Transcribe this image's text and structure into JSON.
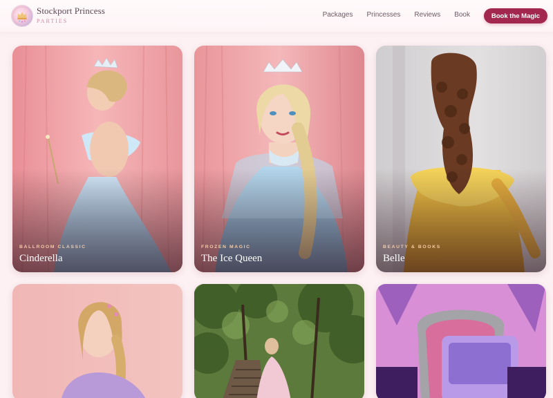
{
  "brand": {
    "name": "Stockport Princess",
    "sub": "PARTIES"
  },
  "nav": {
    "items": [
      "Packages",
      "Princesses",
      "Reviews",
      "Book"
    ],
    "cta": "Book the Magic"
  },
  "colors": {
    "accent": "#a3284f",
    "page_bg": "#fdf1f3",
    "kicker": "#f3c9a3"
  },
  "cards": [
    {
      "kicker": "BALLROOM CLASSIC",
      "title": "Cinderella"
    },
    {
      "kicker": "FROZEN MAGIC",
      "title": "The Ice Queen"
    },
    {
      "kicker": "BEAUTY & BOOKS",
      "title": "Belle"
    },
    {
      "kicker": "",
      "title": ""
    },
    {
      "kicker": "",
      "title": ""
    },
    {
      "kicker": "",
      "title": ""
    }
  ],
  "photos": [
    "photo-cinderella",
    "photo-ice-queen",
    "photo-belle",
    "photo-rapunzel",
    "photo-forest-princess",
    "photo-kpop-throne"
  ]
}
